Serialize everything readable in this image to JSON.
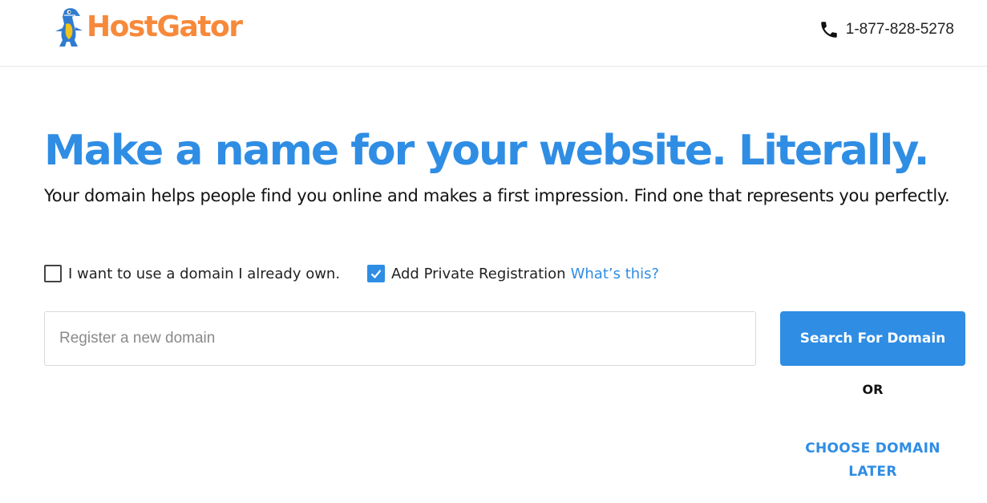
{
  "colors": {
    "brand_orange": "#f7893a",
    "accent_blue": "#2f8de4"
  },
  "header": {
    "logo_text": "HostGator",
    "logo_icon": "gator-mascot-icon",
    "phone_icon": "phone-icon",
    "phone": "1-877-828-5278"
  },
  "hero": {
    "headline": "Make a name for your website. Literally.",
    "subtext": "Your domain helps people find you online and makes a first impression. Find one that represents you perfectly."
  },
  "options": {
    "own_domain": {
      "label": "I want to use a domain I already own.",
      "checked": false
    },
    "private_registration": {
      "label": "Add Private Registration",
      "checked": true,
      "link": "What’s this?"
    }
  },
  "search": {
    "placeholder": "Register a new domain",
    "value": "",
    "button_label": "Search For Domain"
  },
  "or_label": "OR",
  "choose_later_label": "CHOOSE DOMAIN LATER"
}
